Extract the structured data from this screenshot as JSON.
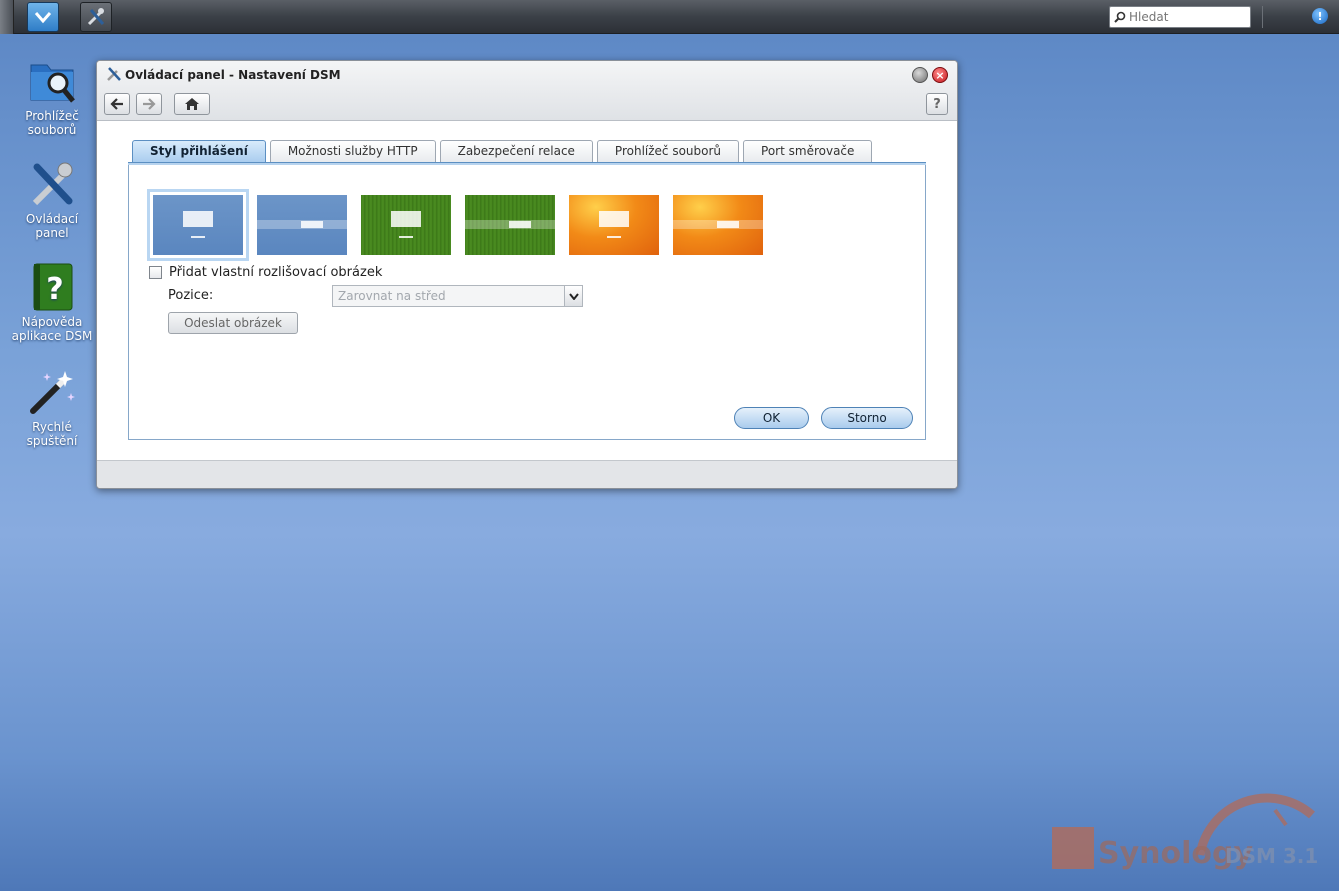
{
  "taskbar": {
    "search_placeholder": "Hledat",
    "notification_badge": "!"
  },
  "desktop": {
    "icons": [
      {
        "label": "Prohlížeč souborů",
        "icon": "folder-search-icon"
      },
      {
        "label": "Ovládací panel",
        "icon": "tools-icon"
      },
      {
        "label": "Nápověda aplikace DSM",
        "icon": "help-book-icon"
      },
      {
        "label": "Rychlé spuštění",
        "icon": "magic-wand-icon"
      }
    ]
  },
  "window": {
    "title": "Ovládací panel - Nastavení DSM",
    "help_label": "?",
    "tabs": [
      {
        "label": "Styl přihlášení",
        "active": true
      },
      {
        "label": "Možnosti služby HTTP",
        "active": false
      },
      {
        "label": "Zabezpečení relace",
        "active": false
      },
      {
        "label": "Prohlížeč souborů",
        "active": false
      },
      {
        "label": "Port směrovače",
        "active": false
      }
    ],
    "themes": [
      {
        "style": "blue-centered",
        "selected": true
      },
      {
        "style": "blue-banner",
        "selected": false
      },
      {
        "style": "green-centered",
        "selected": false
      },
      {
        "style": "green-banner",
        "selected": false
      },
      {
        "style": "orange-centered",
        "selected": false
      },
      {
        "style": "orange-banner",
        "selected": false
      }
    ],
    "custom_image_checkbox": "Přidat vlastní rozlišovací obrázek",
    "position_label": "Pozice:",
    "position_value": "Zarovnat na střed",
    "upload_button": "Odeslat obrázek",
    "ok_button": "OK",
    "cancel_button": "Storno"
  },
  "watermark": {
    "brand": "Synology",
    "product": "DSM 3.1"
  },
  "colors": {
    "desktop_accent": "#7aa2d8",
    "active_tab": "#aacdef",
    "close_button": "#c4161c"
  }
}
